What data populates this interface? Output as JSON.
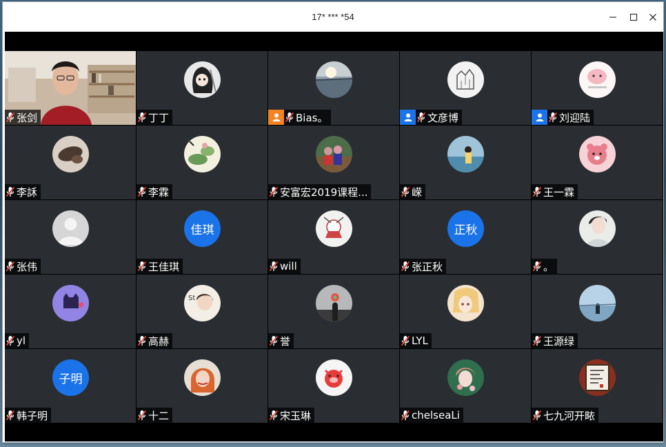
{
  "window": {
    "title": "17* *** *54"
  },
  "colors": {
    "tile_bg": "#2a2d31",
    "host_badge": "#1b73e8",
    "cohost_badge": "#f48321",
    "text_avatar_bg": "#1a73e8",
    "mic_muted": "#e0443a"
  },
  "participants": [
    {
      "name": "张剑",
      "avatar": "camera-video",
      "badge": null
    },
    {
      "name": "丁丁",
      "avatar": "reaper-cartoon-icon",
      "badge": null
    },
    {
      "name": "Bias。",
      "avatar": "sunset-lake-photo",
      "badge": "cohost"
    },
    {
      "name": "文彦博",
      "avatar": "castle-sketch-icon",
      "badge": "host"
    },
    {
      "name": "刘迎陆",
      "avatar": "pink-hamster-icon",
      "badge": "host"
    },
    {
      "name": "李訸",
      "avatar": "dark-object-photo",
      "badge": null
    },
    {
      "name": "李霖",
      "avatar": "lotus-painting-icon",
      "badge": null
    },
    {
      "name": "安富宏2019课程...",
      "avatar": "group-photo",
      "badge": null
    },
    {
      "name": "嵘",
      "avatar": "seaside-girl-photo",
      "badge": null
    },
    {
      "name": "王一霖",
      "avatar": "pink-bear-icon",
      "badge": null
    },
    {
      "name": "张伟",
      "avatar": "default-user-icon",
      "badge": null
    },
    {
      "name": "王佳琪",
      "avatar": "text",
      "avatar_text": "佳琪",
      "badge": null
    },
    {
      "name": "will",
      "avatar": "cartoon-dog-icon",
      "badge": null
    },
    {
      "name": "张正秋",
      "avatar": "text",
      "avatar_text": "正秋",
      "badge": null
    },
    {
      "name": "。",
      "avatar": "girl-portrait-photo",
      "badge": null
    },
    {
      "name": "yl",
      "avatar": "purple-cat-icon",
      "badge": null
    },
    {
      "name": "高赫",
      "avatar": "child-photo",
      "badge": null
    },
    {
      "name": "誉",
      "avatar": "pinwheel-silhouette-photo",
      "badge": null
    },
    {
      "name": "LYL",
      "avatar": "anime-girl-icon",
      "badge": null
    },
    {
      "name": "王源绿",
      "avatar": "riverside-photo",
      "badge": null
    },
    {
      "name": "韩子明",
      "avatar": "text",
      "avatar_text": "子明",
      "badge": null
    },
    {
      "name": "十二",
      "avatar": "orange-hair-photo",
      "badge": null
    },
    {
      "name": "宋玉琳",
      "avatar": "red-piggy-icon",
      "badge": null
    },
    {
      "name": "chelseaLi",
      "avatar": "flower-girl-icon",
      "badge": null
    },
    {
      "name": "七九河开畩",
      "avatar": "calligraphy-frame-icon",
      "badge": null
    }
  ]
}
